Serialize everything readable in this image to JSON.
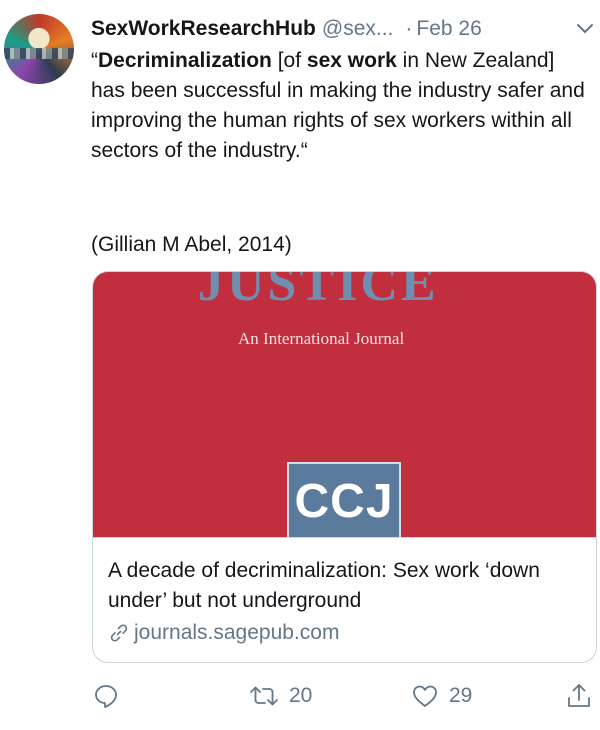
{
  "tweet": {
    "display_name": "SexWorkResearchHub",
    "handle": "@sex...",
    "separator": "·",
    "date": "Feb 26",
    "text_segments": [
      {
        "text": "“",
        "bold": false
      },
      {
        "text": "Decriminalization",
        "bold": true
      },
      {
        "text": " [of ",
        "bold": false
      },
      {
        "text": "sex work",
        "bold": true
      },
      {
        "text": " in New Zealand] has been successful in making the industry safer and improving the human rights of sex workers within all sectors of the industry.“",
        "bold": false
      }
    ],
    "citation": "(Gillian M Abel, 2014)"
  },
  "card": {
    "image": {
      "journal_title": "JUSTICE",
      "journal_subtitle": "An International Journal",
      "logo_text": "CCJ",
      "background_color": "#c12f3e",
      "logo_color": "#5b7b9d"
    },
    "title": "A decade of decriminalization: Sex work ‘down under’ but not underground",
    "domain": "journals.sagepub.com"
  },
  "actions": {
    "reply": {
      "icon": "reply-icon"
    },
    "retweet": {
      "icon": "retweet-icon",
      "count": "20"
    },
    "like": {
      "icon": "heart-icon",
      "count": "29"
    },
    "share": {
      "icon": "share-icon"
    }
  },
  "colors": {
    "text": "#14171a",
    "secondary": "#657786",
    "border": "#ccd6dd"
  }
}
